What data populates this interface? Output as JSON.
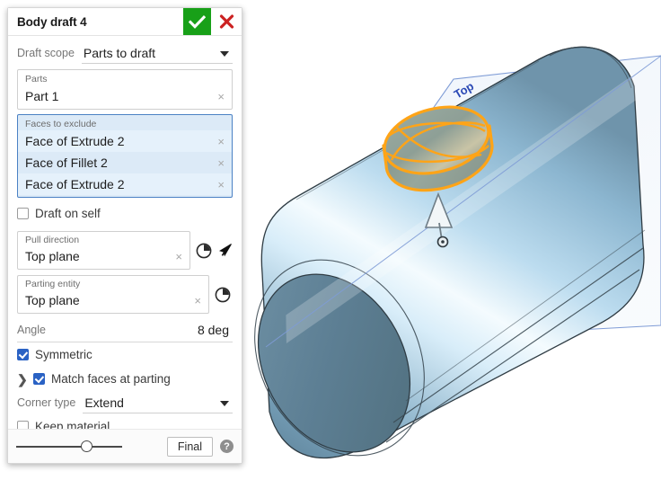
{
  "dialog": {
    "title": "Body draft 4",
    "accept_icon": "check-icon",
    "cancel_icon": "close-icon",
    "draft_scope": {
      "label": "Draft scope",
      "value": "Parts to draft",
      "caret_icon": "chevron-down-icon"
    },
    "parts": {
      "caption": "Parts",
      "items": [
        {
          "text": "Part 1",
          "remove_icon": "×"
        }
      ]
    },
    "faces_to_exclude": {
      "caption": "Faces to exclude",
      "items": [
        {
          "text": "Face of Extrude 2",
          "remove_icon": "×"
        },
        {
          "text": "Face of Fillet 2",
          "remove_icon": "×"
        },
        {
          "text": "Face of Extrude 2",
          "remove_icon": "×"
        }
      ]
    },
    "draft_on_self": {
      "label": "Draft on self",
      "checked": false
    },
    "pull_direction": {
      "caption": "Pull direction",
      "value": "Top plane",
      "remove_icon": "×",
      "flip_icon": "flip-direction-icon",
      "select_icon": "cursor-arrow-icon"
    },
    "parting_entity": {
      "caption": "Parting entity",
      "value": "Top plane",
      "remove_icon": "×",
      "flip_icon": "flip-direction-icon"
    },
    "angle": {
      "label": "Angle",
      "value": "8 deg"
    },
    "symmetric": {
      "label": "Symmetric",
      "checked": true
    },
    "match_faces": {
      "label": "Match faces at parting",
      "checked": true,
      "expander_icon": "❯"
    },
    "corner_type": {
      "label": "Corner type",
      "value": "Extend",
      "caret_icon": "chevron-down-icon"
    },
    "keep_material": {
      "label": "Keep material",
      "checked": false
    },
    "footer": {
      "slider_name": "rollback-slider",
      "final_label": "Final",
      "help_icon": "?"
    }
  },
  "viewport": {
    "plane_label": "Top",
    "direction_arrow_icon": "pull-direction-arrow-icon",
    "colors": {
      "highlight_orange": "#ffa417",
      "plane_blue": "#6f8fd0",
      "body_light": "#d9eaf6",
      "body_mid": "#8fb8d4",
      "body_dark": "#4e7389",
      "label_blue": "#2b49b5"
    }
  }
}
